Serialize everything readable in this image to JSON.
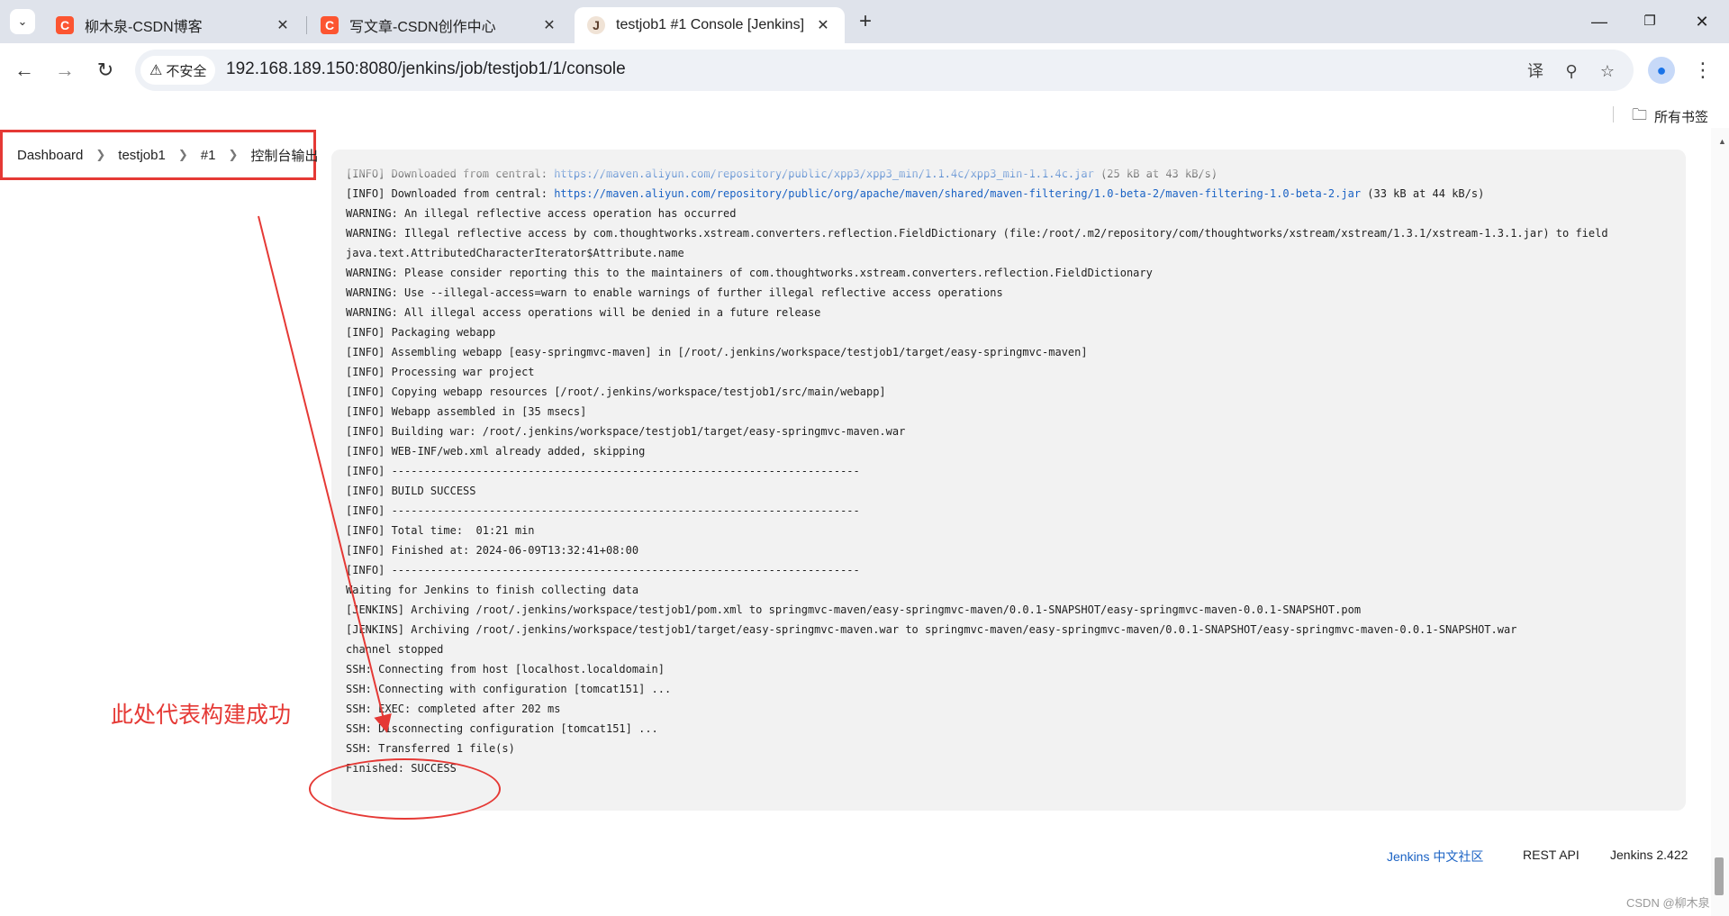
{
  "tabs": [
    {
      "title": "柳木泉-CSDN博客",
      "favicon": "csdn-icon",
      "color": "#fc5531"
    },
    {
      "title": "写文章-CSDN创作中心",
      "favicon": "csdn-icon",
      "color": "#fc5531"
    },
    {
      "title": "testjob1 #1 Console [Jenkins]",
      "favicon": "jenkins-icon",
      "active": true
    }
  ],
  "toolbar": {
    "security_label": "不安全",
    "url": "192.168.189.150:8080/jenkins/job/testjob1/1/console"
  },
  "bookmarks": {
    "all_bookmarks": "所有书签"
  },
  "breadcrumb": [
    "Dashboard",
    "testjob1",
    "#1",
    "控制台输出"
  ],
  "console_lines": [
    {
      "text": "[INFO] Downloaded from central: ",
      "link": "https://maven.aliyun.com/repository/public/xpp3/xpp3_min/1.1.4c/xpp3_min-1.1.4c.jar",
      "suffix": " (25 kB at 43 kB/s)"
    },
    {
      "text": "[INFO] Downloaded from central: ",
      "link": "https://maven.aliyun.com/repository/public/org/apache/maven/shared/maven-filtering/1.0-beta-2/maven-filtering-1.0-beta-2.jar",
      "suffix": " (33 kB at 44 kB/s)"
    },
    {
      "text": "WARNING: An illegal reflective access operation has occurred"
    },
    {
      "text": "WARNING: Illegal reflective access by com.thoughtworks.xstream.converters.reflection.FieldDictionary (file:/root/.m2/repository/com/thoughtworks/xstream/xstream/1.3.1/xstream-1.3.1.jar) to field"
    },
    {
      "text": "java.text.AttributedCharacterIterator$Attribute.name"
    },
    {
      "text": "WARNING: Please consider reporting this to the maintainers of com.thoughtworks.xstream.converters.reflection.FieldDictionary"
    },
    {
      "text": "WARNING: Use --illegal-access=warn to enable warnings of further illegal reflective access operations"
    },
    {
      "text": "WARNING: All illegal access operations will be denied in a future release"
    },
    {
      "text": "[INFO] Packaging webapp"
    },
    {
      "text": "[INFO] Assembling webapp [easy-springmvc-maven] in [/root/.jenkins/workspace/testjob1/target/easy-springmvc-maven]"
    },
    {
      "text": "[INFO] Processing war project"
    },
    {
      "text": "[INFO] Copying webapp resources [/root/.jenkins/workspace/testjob1/src/main/webapp]"
    },
    {
      "text": "[INFO] Webapp assembled in [35 msecs]"
    },
    {
      "text": "[INFO] Building war: /root/.jenkins/workspace/testjob1/target/easy-springmvc-maven.war"
    },
    {
      "text": "[INFO] WEB-INF/web.xml already added, skipping"
    },
    {
      "text": "[INFO] ------------------------------------------------------------------------"
    },
    {
      "text": "[INFO] BUILD SUCCESS"
    },
    {
      "text": "[INFO] ------------------------------------------------------------------------"
    },
    {
      "text": "[INFO] Total time:  01:21 min"
    },
    {
      "text": "[INFO] Finished at: 2024-06-09T13:32:41+08:00"
    },
    {
      "text": "[INFO] ------------------------------------------------------------------------"
    },
    {
      "text": "Waiting for Jenkins to finish collecting data"
    },
    {
      "text": "[JENKINS] Archiving /root/.jenkins/workspace/testjob1/pom.xml to springmvc-maven/easy-springmvc-maven/0.0.1-SNAPSHOT/easy-springmvc-maven-0.0.1-SNAPSHOT.pom"
    },
    {
      "text": "[JENKINS] Archiving /root/.jenkins/workspace/testjob1/target/easy-springmvc-maven.war to springmvc-maven/easy-springmvc-maven/0.0.1-SNAPSHOT/easy-springmvc-maven-0.0.1-SNAPSHOT.war"
    },
    {
      "text": "channel stopped"
    },
    {
      "text": "SSH: Connecting from host [localhost.localdomain]"
    },
    {
      "text": "SSH: Connecting with configuration [tomcat151] ..."
    },
    {
      "text": "SSH: EXEC: completed after 202 ms"
    },
    {
      "text": "SSH: Disconnecting configuration [tomcat151] ..."
    },
    {
      "text": "SSH: Transferred 1 file(s)"
    },
    {
      "text": "Finished: SUCCESS"
    }
  ],
  "annotation": {
    "text": "此处代表构建成功",
    "color": "#e53935"
  },
  "footer": {
    "community": "Jenkins 中文社区",
    "rest_api": "REST API",
    "version": "Jenkins 2.422"
  },
  "watermark": "CSDN @柳木泉"
}
